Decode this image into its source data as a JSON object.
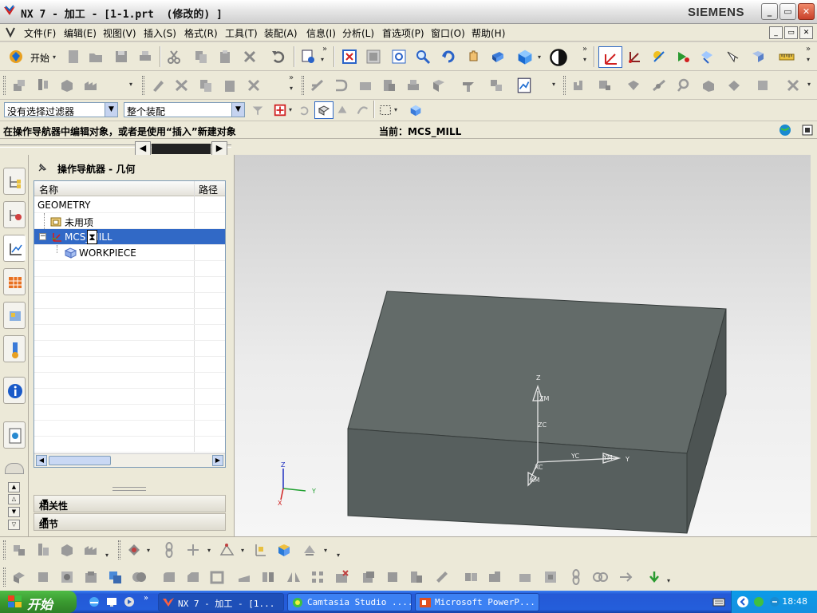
{
  "window": {
    "title": "NX 7 - 加工 - [1-1.prt  (修改的) ]",
    "brand": "SIEMENS",
    "minimize_label": "_",
    "maximize_label": "▭",
    "close_label": "✕"
  },
  "menu": {
    "items": [
      "文件(F)",
      "编辑(E)",
      "视图(V)",
      "插入(S)",
      "格式(R)",
      "工具(T)",
      "装配(A)",
      "信息(I)",
      "分析(L)",
      "首选项(P)",
      "窗口(O)",
      "帮助(H)"
    ]
  },
  "toolbar": {
    "start_label": "开始",
    "filter_value": "没有选择过滤器",
    "assembly_scope_value": "整个装配"
  },
  "status": {
    "prompt": "在操作导航器中编辑对象，或者是使用“插入”新建对象",
    "current": "当前：MCS_MILL"
  },
  "navigator": {
    "title": "操作导航器 - 几何",
    "columns": [
      "名称",
      "路径"
    ],
    "rows": [
      {
        "label": "GEOMETRY",
        "icon": "none"
      },
      {
        "label": "未用项",
        "icon": "unused-folder-icon"
      },
      {
        "label": "MCS_MILL",
        "icon": "mcs-icon"
      },
      {
        "label": "WORKPIECE",
        "icon": "workpiece-icon"
      }
    ],
    "selected_row": "MCS_MILL",
    "sections": [
      "相关性",
      "细节"
    ]
  },
  "viewport": {
    "axis_labels": {
      "z": "Z",
      "zm": "ZM",
      "zc": "ZC",
      "yc": "YC",
      "ym": "YM",
      "y": "Y",
      "xc": "XC",
      "xm": "XM"
    },
    "triad_labels": {
      "z": "Z",
      "y": "Y",
      "x": "X"
    }
  },
  "taskbar": {
    "start_label": "开始",
    "tasks": [
      "NX 7 - 加工 - [1...",
      "Camtasia Studio ....",
      "Microsoft PowerP..."
    ],
    "clock": "18:48"
  }
}
